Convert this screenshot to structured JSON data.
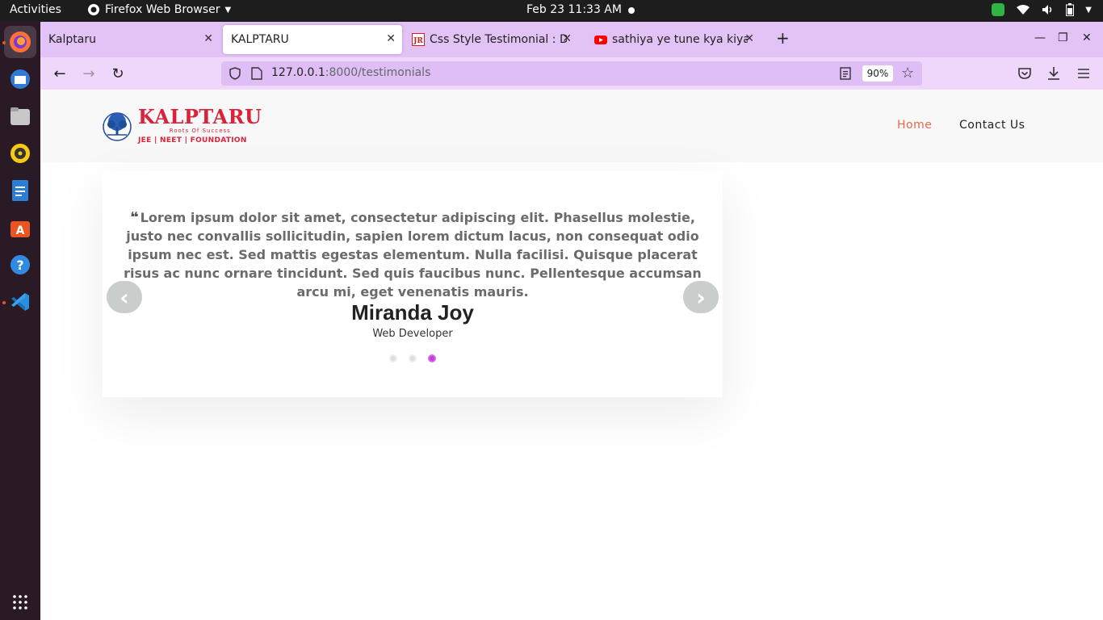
{
  "system": {
    "activities": "Activities",
    "app_name": "Firefox Web Browser",
    "clock": "Feb 23  11:33 AM"
  },
  "browser": {
    "tabs": [
      {
        "label": "Kalptaru",
        "active": false
      },
      {
        "label": "KALPTARU",
        "active": true
      },
      {
        "label": "Css Style Testimonial : De",
        "active": false
      },
      {
        "label": "sathiya ye tune kya kiya f",
        "active": false
      }
    ],
    "url_host": "127.0.0.1",
    "url_rest": ":8000/testimonials",
    "zoom": "90%"
  },
  "site": {
    "logo": {
      "title": "KALPTARU",
      "subtitle": "Roots Of Success",
      "tagline": "JEE | NEET | FOUNDATION"
    },
    "nav": {
      "home": "Home",
      "contact": "Contact Us"
    },
    "testimonial": {
      "quote_mark": "❝",
      "text": "Lorem ipsum dolor sit amet, consectetur adipiscing elit. Phasellus molestie, justo nec convallis sollicitudin, sapien lorem dictum lacus, non consequat odio ipsum nec est. Sed mattis egestas elementum. Nulla facilisi. Quisque placerat risus ac nunc ornare tincidunt. Sed quis faucibus nunc. Pellentesque accumsan arcu mi, eget venenatis mauris.",
      "name": "Miranda Joy",
      "role": "Web Developer",
      "slide_count": 3,
      "active_slide": 3
    }
  },
  "colors": {
    "brand_red": "#d9233a",
    "nav_active": "#e46a4c",
    "dot_active": "#c03bd8",
    "tabbar": "#e3c2f5"
  }
}
